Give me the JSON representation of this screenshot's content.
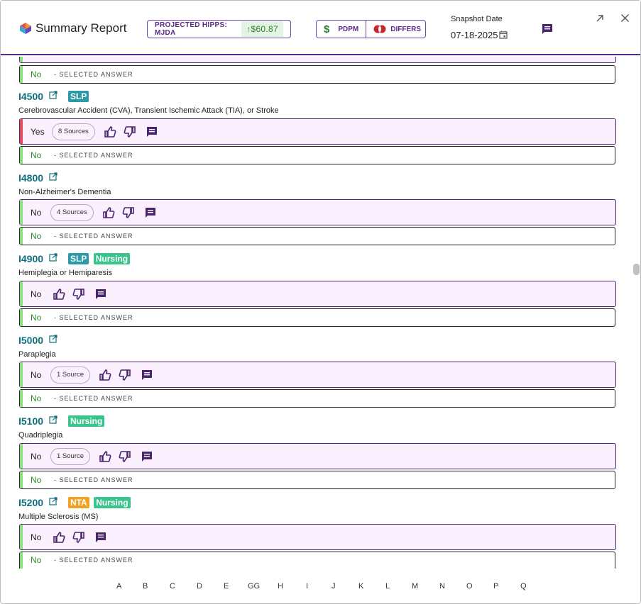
{
  "header": {
    "title": "Summary Report",
    "hipps_label": "PROJECTED HIPPS: MJDA",
    "hipps_value": "↑$60.87",
    "pdpm_label": "PDPM",
    "differs_label": "DIFFERS",
    "snapshot_label": "Snapshot Date",
    "snapshot_date": "07-18-2025"
  },
  "colors": {
    "accent": "#5b2a86",
    "code": "#0f6f7b",
    "selected_green": "#2e8b2e"
  },
  "selected_answer_text": "- SELECTED ANSWER",
  "top_partial": {
    "selected_value": "No"
  },
  "items": [
    {
      "code": "I4500",
      "tags": [
        "SLP"
      ],
      "description": "Cerebrovascular Accident (CVA), Transient Ischemic Attack (TIA), or Stroke",
      "answer": "Yes",
      "sources": "8 Sources",
      "selected": "No"
    },
    {
      "code": "I4800",
      "tags": [],
      "description": "Non-Alzheimer's Dementia",
      "answer": "No",
      "sources": "4 Sources",
      "selected": "No"
    },
    {
      "code": "I4900",
      "tags": [
        "SLP",
        "Nursing"
      ],
      "description": "Hemiplegia or Hemiparesis",
      "answer": "No",
      "sources": "",
      "selected": "No"
    },
    {
      "code": "I5000",
      "tags": [],
      "description": "Paraplegia",
      "answer": "No",
      "sources": "1 Source",
      "selected": "No"
    },
    {
      "code": "I5100",
      "tags": [
        "Nursing"
      ],
      "description": "Quadriplegia",
      "answer": "No",
      "sources": "1 Source",
      "selected": "No"
    },
    {
      "code": "I5200",
      "tags": [
        "NTA",
        "Nursing"
      ],
      "description": "Multiple Sclerosis (MS)",
      "answer": "No",
      "sources": "",
      "selected": "No"
    }
  ],
  "alphabet": [
    "A",
    "B",
    "C",
    "D",
    "E",
    "GG",
    "H",
    "I",
    "J",
    "K",
    "L",
    "M",
    "N",
    "O",
    "P",
    "Q"
  ]
}
